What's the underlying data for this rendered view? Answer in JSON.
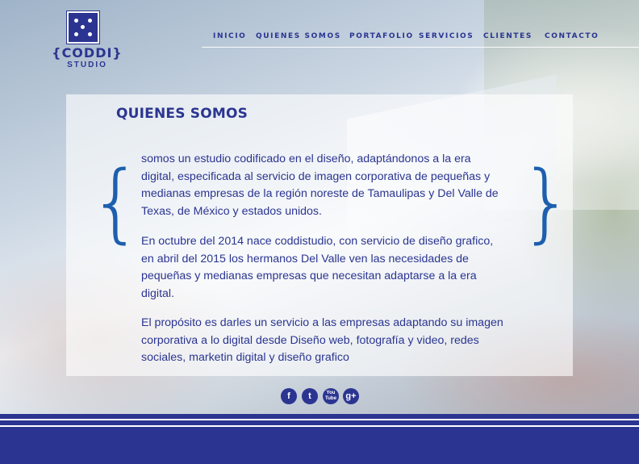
{
  "logo": {
    "brand": "{CODDI}",
    "sub": "STUDIO"
  },
  "nav": {
    "items": [
      {
        "label": "INICIO"
      },
      {
        "label": "QUIENES SOMOS"
      },
      {
        "label": "PORTAFOLIO"
      },
      {
        "label": "SERVICIOS"
      },
      {
        "label": "CLIENTES"
      },
      {
        "label": "CONTACTO"
      }
    ]
  },
  "content": {
    "title": "QUIENES SOMOS",
    "brace_left": "{",
    "brace_right": "}",
    "paragraphs": [
      "somos  un estudio codificado en el diseño, adaptándonos a la era digital, especificada al servicio de imagen corporativa de pequeñas y medianas empresas de la región noreste de Tamaulipas y Del Valle de Texas, de México y estados unidos.",
      "En octubre del 2014 nace coddistudio, con servicio de diseño grafico, en abril del 2015 los hermanos Del Valle ven las necesidades de pequeñas y medianas empresas que  necesitan adaptarse a la era digital.",
      "El propósito es darles un servicio a las empresas  adaptando su imagen corporativa a lo digital desde Diseño web, fotografía y video, redes sociales, marketin digital y diseño grafico"
    ]
  },
  "social": {
    "facebook": "f",
    "twitter": "t",
    "youtube_line1": "You",
    "youtube_line2": "Tube",
    "googleplus": "g+"
  },
  "colors": {
    "brand_blue": "#2b3591",
    "brace_blue": "#1d5fae",
    "footer": "#2b3591"
  }
}
